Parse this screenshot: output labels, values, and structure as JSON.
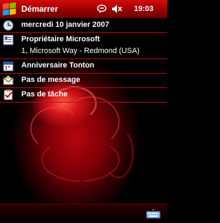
{
  "taskbar": {
    "title": "Démarrer",
    "clock": "19:03",
    "start_icon": "windows-flag-icon",
    "notification_icon": "chat-bubble-icon",
    "volume_icon": "speaker-mute-icon"
  },
  "today": {
    "date": "mercredi 10 janvier 2007",
    "owner_name": "Propriétaire Microsoft",
    "owner_address": "1, Microsoft Way - Redmond (USA)",
    "appointment": "Anniversaire Tonton",
    "messages": "Pas de message",
    "tasks": "Pas de tâche"
  },
  "bottom": {
    "input_icon": "keyboard-icon"
  },
  "colors": {
    "titlebar": "#b40808",
    "separator": "#b31212",
    "background": "#000000",
    "rose": "#c00a10"
  }
}
